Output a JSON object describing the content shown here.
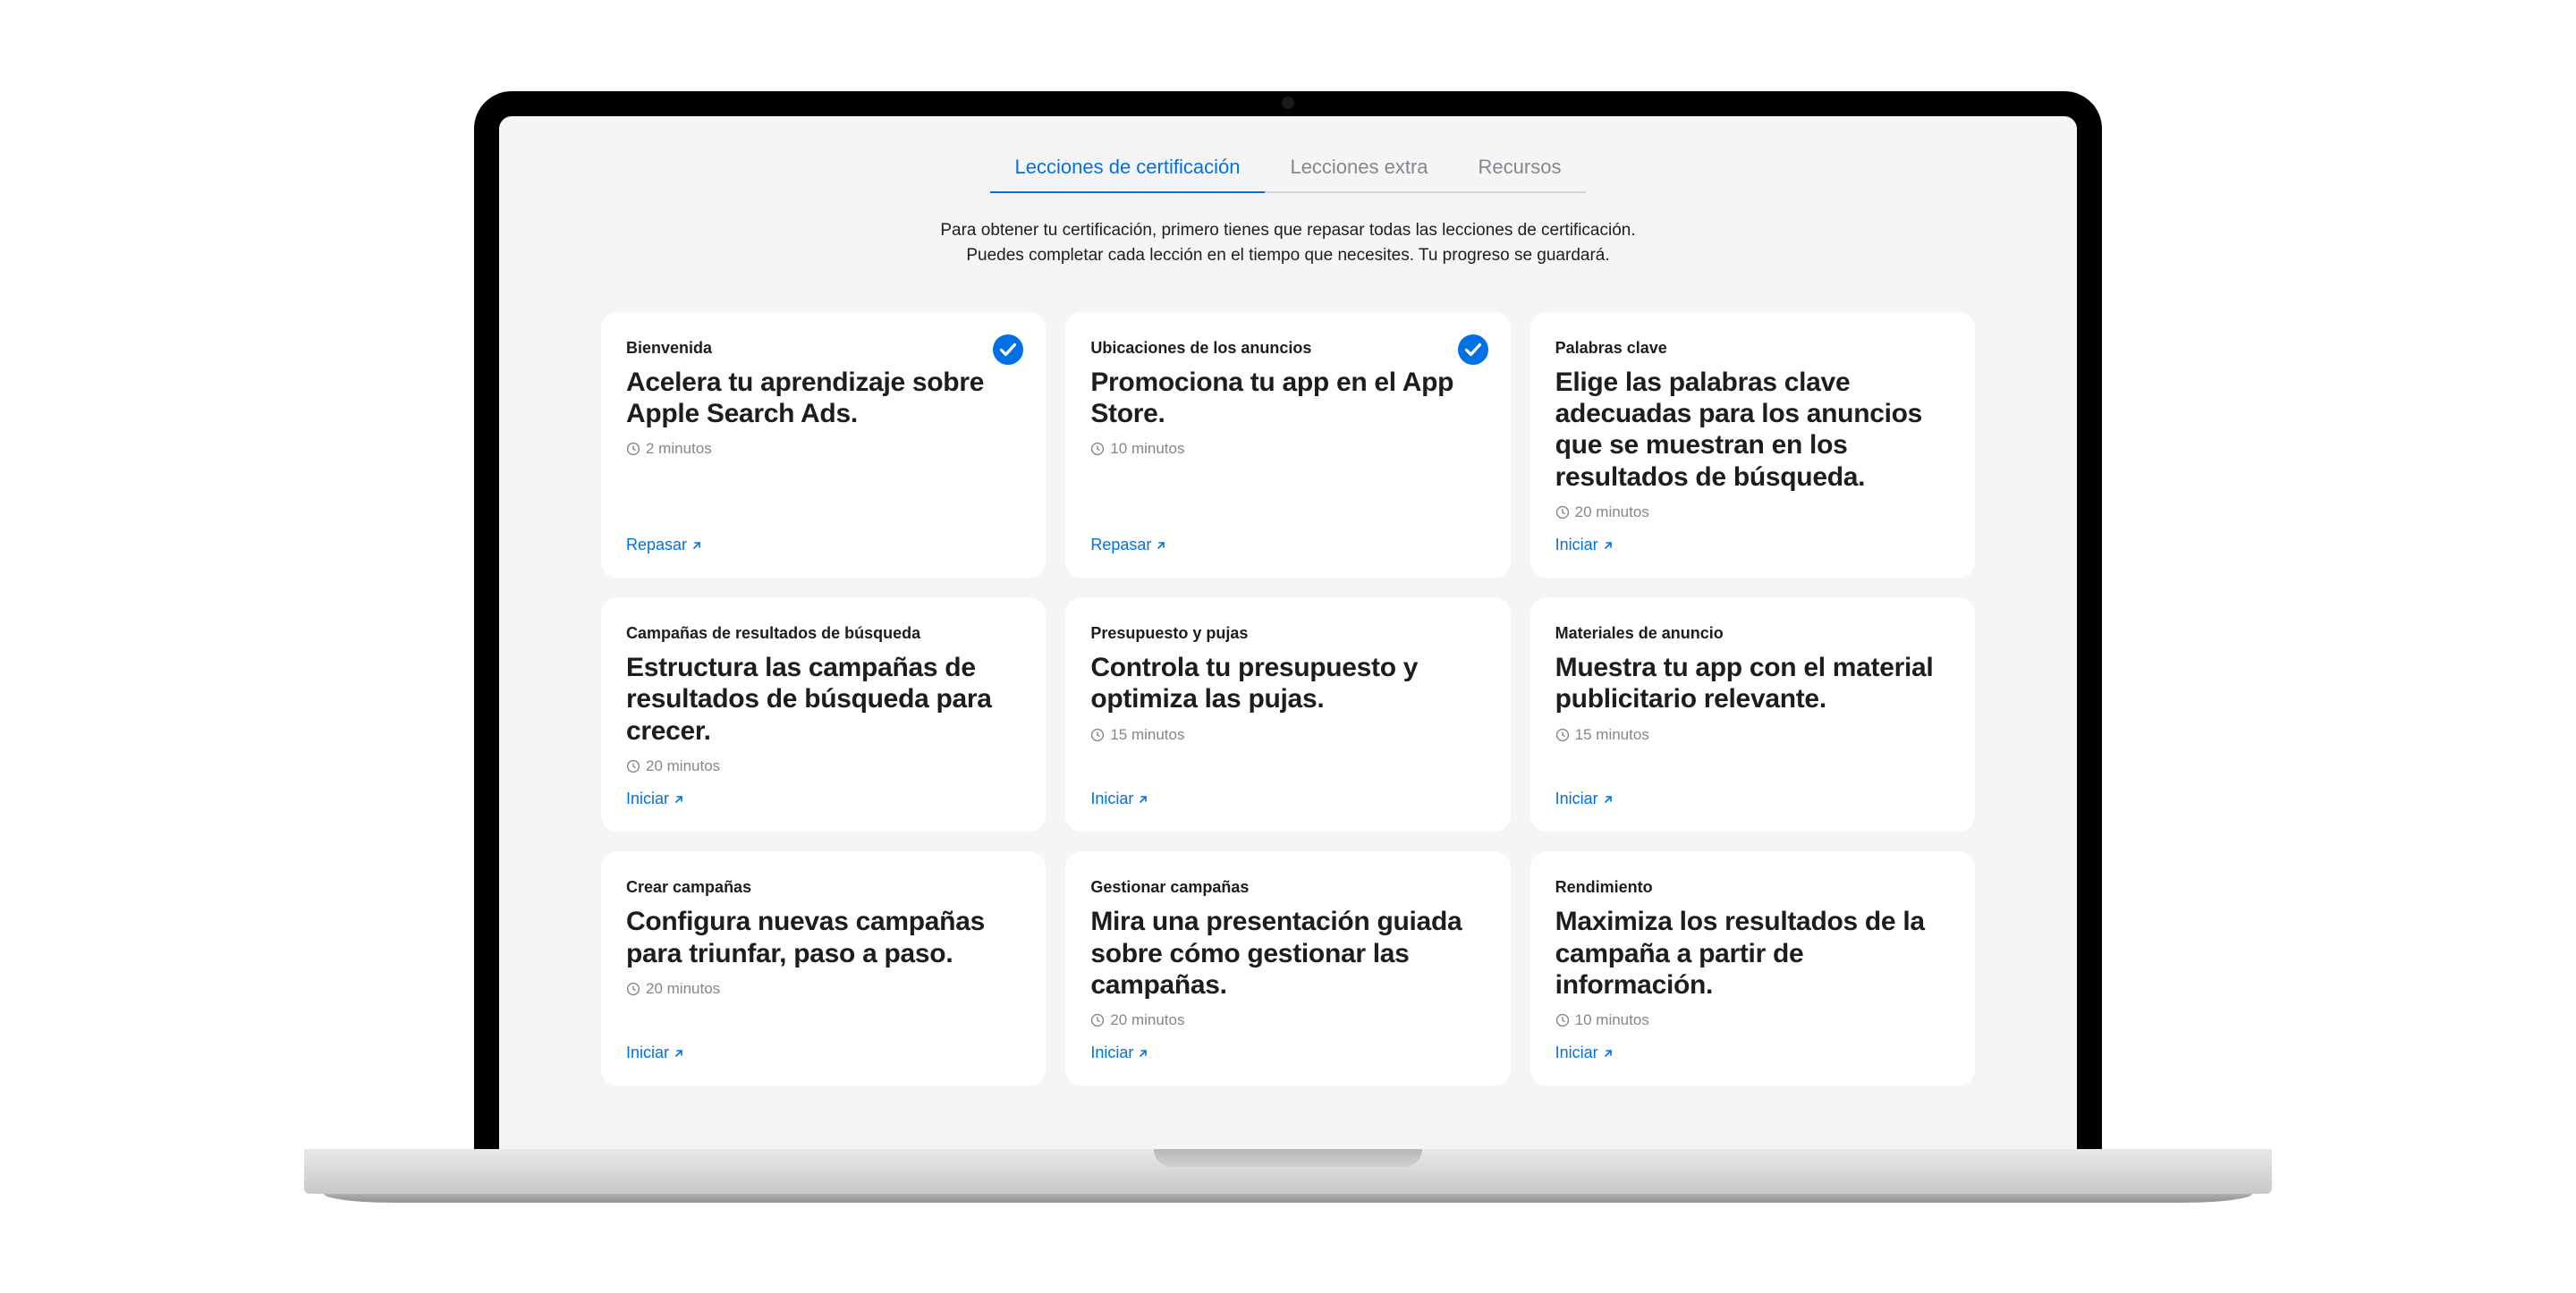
{
  "tabs": [
    {
      "label": "Lecciones de certificación",
      "active": true
    },
    {
      "label": "Lecciones extra",
      "active": false
    },
    {
      "label": "Recursos",
      "active": false
    }
  ],
  "description": {
    "line1": "Para obtener tu certificación, primero tienes que repasar todas las lecciones de certificación.",
    "line2": "Puedes completar cada lección en el tiempo que necesites. Tu progreso se guardará."
  },
  "cards": [
    {
      "category": "Bienvenida",
      "title": "Acelera tu aprendizaje sobre Apple Search Ads.",
      "duration": "2 minutos",
      "action": "Repasar",
      "completed": true
    },
    {
      "category": "Ubicaciones de los anuncios",
      "title": "Promociona tu app en el App Store.",
      "duration": "10 minutos",
      "action": "Repasar",
      "completed": true
    },
    {
      "category": "Palabras clave",
      "title": "Elige las palabras clave adecuadas para los anuncios que se muestran en los resultados de búsqueda.",
      "duration": "20 minutos",
      "action": "Iniciar",
      "completed": false
    },
    {
      "category": "Campañas de resultados de búsqueda",
      "title": "Estructura las campañas de resultados de búsqueda para crecer.",
      "duration": "20 minutos",
      "action": "Iniciar",
      "completed": false
    },
    {
      "category": "Presupuesto y pujas",
      "title": "Controla tu presupuesto y optimiza las pujas.",
      "duration": "15 minutos",
      "action": "Iniciar",
      "completed": false
    },
    {
      "category": "Materiales de anuncio",
      "title": "Muestra tu app con el material publicitario relevante.",
      "duration": "15 minutos",
      "action": "Iniciar",
      "completed": false
    },
    {
      "category": "Crear campañas",
      "title": "Configura nuevas campañas para triunfar, paso a paso.",
      "duration": "20 minutos",
      "action": "Iniciar",
      "completed": false
    },
    {
      "category": "Gestionar campañas",
      "title": "Mira una presentación guiada sobre cómo gestionar las campañas.",
      "duration": "20 minutos",
      "action": "Iniciar",
      "completed": false
    },
    {
      "category": "Rendimiento",
      "title": "Maximiza los resultados de la campaña a partir de información.",
      "duration": "10 minutos",
      "action": "Iniciar",
      "completed": false
    }
  ]
}
